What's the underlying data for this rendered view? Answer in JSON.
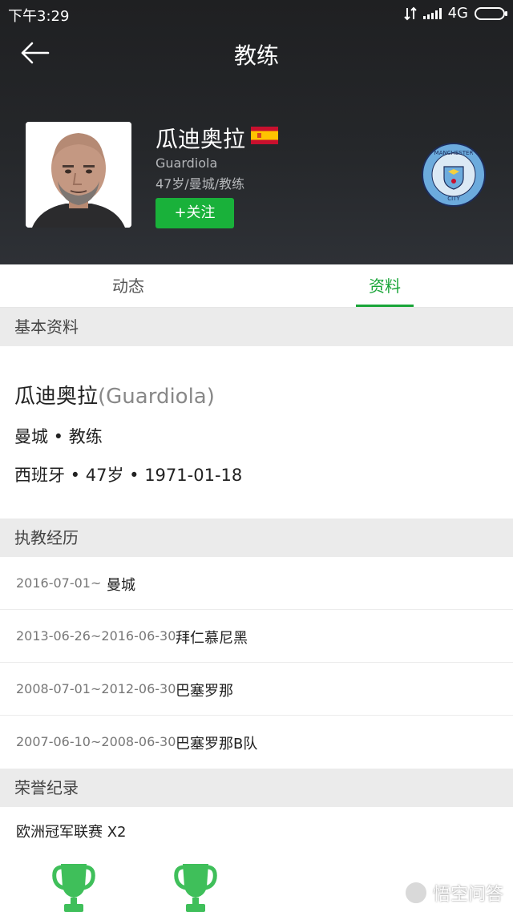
{
  "status_bar": {
    "time": "下午3:29",
    "network": "4G"
  },
  "header": {
    "title": "教练"
  },
  "profile": {
    "name": "瓜迪奥拉",
    "name_en": "Guardiola",
    "subtitle": "47岁/曼城/教练",
    "follow_label": "+关注",
    "flag": "spain-flag-icon",
    "club_badge_text": {
      "top": "MANCHESTER",
      "bottom": "CITY"
    }
  },
  "tabs": [
    {
      "label": "动态",
      "active": false
    },
    {
      "label": "资料",
      "active": true
    }
  ],
  "basic_info": {
    "section_title": "基本资料",
    "name": "瓜迪奥拉",
    "name_en": "(Guardiola)",
    "line2": "曼城 • 教练",
    "line3": "西班牙 • 47岁 • 1971-01-18"
  },
  "career": {
    "section_title": "执教经历",
    "rows": [
      {
        "dates": "2016-07-01~",
        "club": "曼城"
      },
      {
        "dates": "2013-06-26~2016-06-30",
        "club": "拜仁慕尼黑"
      },
      {
        "dates": "2008-07-01~2012-06-30",
        "club": "巴塞罗那"
      },
      {
        "dates": "2007-06-10~2008-06-30",
        "club": "巴塞罗那B队"
      }
    ]
  },
  "honors": {
    "section_title": "荣誉纪录",
    "item_title": "欧洲冠军联赛 X2",
    "trophy_count": 2,
    "trophy_color": "#3fbf5a"
  },
  "watermark": {
    "text": "悟空问答"
  },
  "colors": {
    "accent": "#19a538",
    "follow_button": "#19b13a",
    "hero_bg": "#25272a"
  }
}
